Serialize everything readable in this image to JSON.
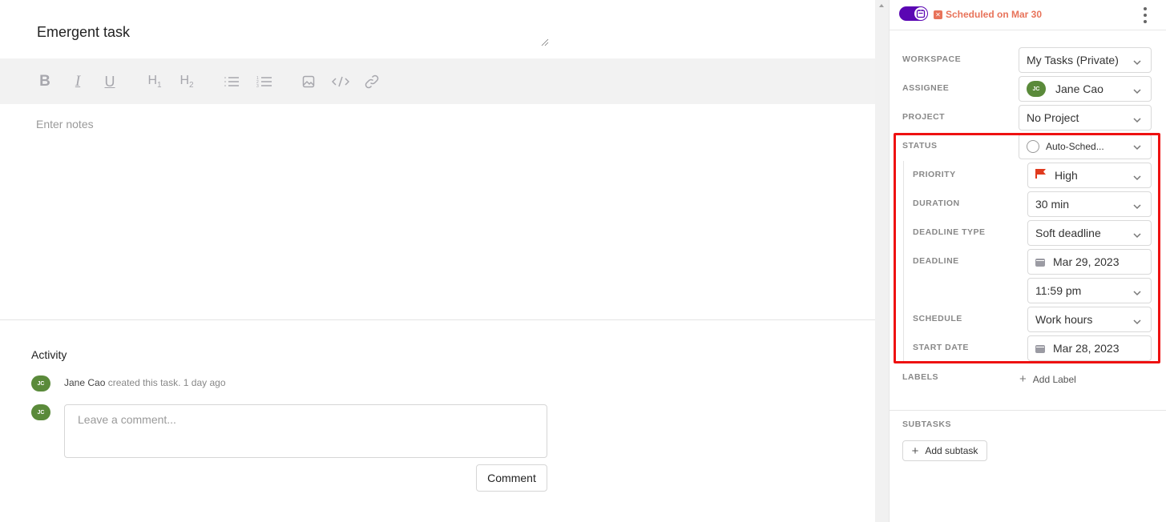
{
  "task": {
    "title": "Emergent task",
    "notes_placeholder": "Enter notes"
  },
  "toolbar": {
    "buttons": [
      {
        "name": "bold",
        "label": "B"
      },
      {
        "name": "italic",
        "label": "I"
      },
      {
        "name": "underline",
        "label": "U"
      },
      {
        "name": "heading-1",
        "label": "H1"
      },
      {
        "name": "heading-2",
        "label": "H2"
      },
      {
        "name": "bullet-list",
        "label": ""
      },
      {
        "name": "numbered-list",
        "label": ""
      },
      {
        "name": "image",
        "label": ""
      },
      {
        "name": "code",
        "label": ""
      },
      {
        "name": "link",
        "label": ""
      }
    ]
  },
  "activity": {
    "title": "Activity",
    "entries": [
      {
        "avatar": "JC",
        "actor": "Jane Cao",
        "action": "created this task.",
        "time": "1 day ago"
      }
    ],
    "comment_avatar": "JC",
    "comment_placeholder": "Leave a comment...",
    "comment_button": "Comment"
  },
  "panel": {
    "header": {
      "auto_schedule_toggle": true,
      "scheduled_text": "Scheduled on Mar 30",
      "scheduled_color": "#e8735a",
      "toggle_color": "#5a06b3"
    },
    "fields": {
      "workspace": {
        "label": "WORKSPACE",
        "value": "My Tasks (Private)"
      },
      "assignee": {
        "label": "ASSIGNEE",
        "value": "Jane Cao",
        "avatar": "JC"
      },
      "project": {
        "label": "PROJECT",
        "value": "No Project"
      },
      "status": {
        "label": "STATUS",
        "value": "Auto-Sched..."
      },
      "priority": {
        "label": "PRIORITY",
        "value": "High",
        "flag_color": "#e03a1e"
      },
      "duration": {
        "label": "DURATION",
        "value": "30 min"
      },
      "deadline_type": {
        "label": "DEADLINE TYPE",
        "value": "Soft deadline"
      },
      "deadline": {
        "label": "DEADLINE",
        "date": "Mar 29, 2023",
        "time": "11:59 pm"
      },
      "schedule": {
        "label": "SCHEDULE",
        "value": "Work hours"
      },
      "start_date": {
        "label": "START DATE",
        "value": "Mar 28, 2023"
      },
      "labels": {
        "label": "LABELS",
        "add_label": "Add Label"
      }
    },
    "subtasks": {
      "label": "SUBTASKS",
      "add_button": "Add subtask"
    },
    "highlight_color": "#ee1111"
  }
}
